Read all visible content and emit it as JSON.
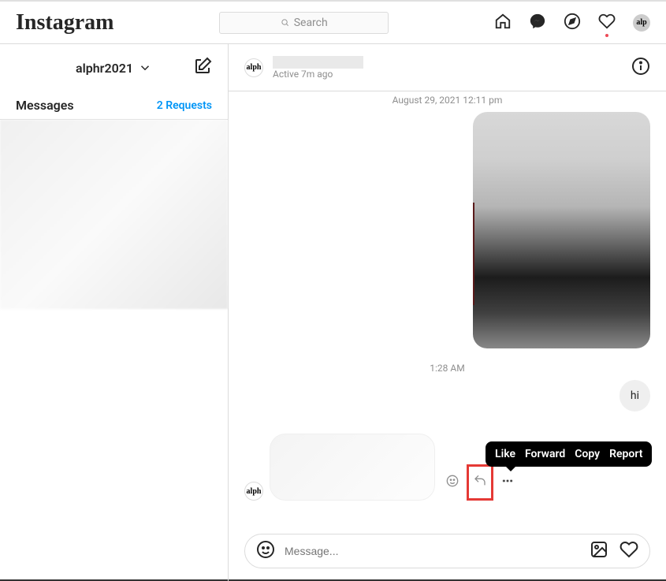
{
  "brand": "Instagram",
  "search": {
    "placeholder": "Search"
  },
  "nav_avatar_text": "alp",
  "sidebar": {
    "username": "alphr2021",
    "tabs": {
      "messages": "Messages",
      "requests": "2 Requests"
    }
  },
  "chat": {
    "header": {
      "avatar_text": "alph",
      "username": "",
      "status": "Active 7m ago"
    },
    "date": "August 29, 2021 12:11 pm",
    "time_2": "1:28 AM",
    "msg_hi": "hi",
    "incoming_avatar_text": "alph",
    "tooltip": {
      "like": "Like",
      "forward": "Forward",
      "copy": "Copy",
      "report": "Report"
    },
    "composer": {
      "placeholder": "Message..."
    }
  }
}
